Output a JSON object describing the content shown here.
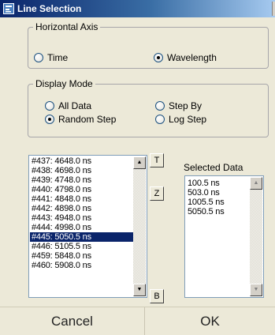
{
  "window": {
    "title": "Line Selection"
  },
  "horizontal_axis": {
    "legend": "Horizontal Axis",
    "options": [
      {
        "label": "Time",
        "selected": false
      },
      {
        "label": "Wavelength",
        "selected": true
      }
    ]
  },
  "display_mode": {
    "legend": "Display Mode",
    "options": [
      {
        "label": "All Data",
        "selected": false
      },
      {
        "label": "Step By",
        "selected": false
      },
      {
        "label": "Random Step",
        "selected": true
      },
      {
        "label": "Log Step",
        "selected": false
      }
    ]
  },
  "line_list": {
    "items": [
      "#437: 4648.0 ns",
      "#438: 4698.0 ns",
      "#439: 4748.0 ns",
      "#440: 4798.0 ns",
      "#441: 4848.0 ns",
      "#442: 4898.0 ns",
      "#443: 4948.0 ns",
      "#444: 4998.0 ns",
      "#445: 5050.5 ns",
      "#446: 5105.5 ns",
      "#459: 5848.0 ns",
      "#460: 5908.0 ns"
    ],
    "selected_index": 8
  },
  "nav_buttons": {
    "top": "T",
    "middle": "Z",
    "bottom": "B"
  },
  "selected_data": {
    "caption": "Selected Data",
    "items": [
      "100.5 ns",
      "503.0 ns",
      "1005.5 ns",
      "5050.5 ns"
    ]
  },
  "footer": {
    "cancel": "Cancel",
    "ok": "OK"
  }
}
